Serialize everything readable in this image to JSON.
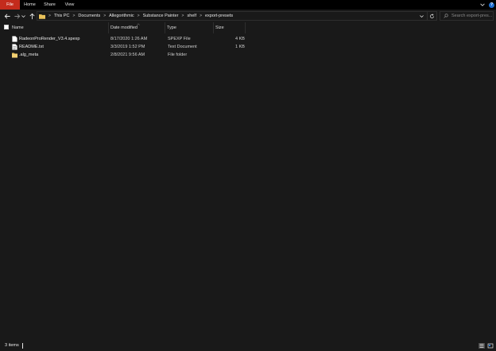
{
  "ribbon": {
    "tabs": [
      "File",
      "Home",
      "Share",
      "View"
    ]
  },
  "address": {
    "crumbs": [
      "This PC",
      "Documents",
      "Allegorithmic",
      "Substance Painter",
      "shelf",
      "export-presets"
    ],
    "separator": ">"
  },
  "search": {
    "placeholder": "Search export-pres..."
  },
  "columns": {
    "name": "Name",
    "date": "Date modified",
    "type": "Type",
    "size": "Size"
  },
  "files": [
    {
      "name": "RadeonProRender_V3.4.spexp",
      "date": "8/17/2020 1:26 AM",
      "type": "SPEXP File",
      "size": "4 KB",
      "icon": "file-icon"
    },
    {
      "name": "README.txt",
      "date": "3/3/2019 1:52 PM",
      "type": "Text Document",
      "size": "1 KB",
      "icon": "text-file-icon"
    },
    {
      "name": ".alg_meta",
      "date": "2/8/2021 9:56 AM",
      "type": "File folder",
      "size": "",
      "icon": "folder-icon"
    }
  ],
  "status": {
    "items": "3 items"
  },
  "colors": {
    "background": "#191919",
    "file_tab": "#c42b1c",
    "help": "#1f6fd1",
    "folder": "#e8c15a"
  }
}
